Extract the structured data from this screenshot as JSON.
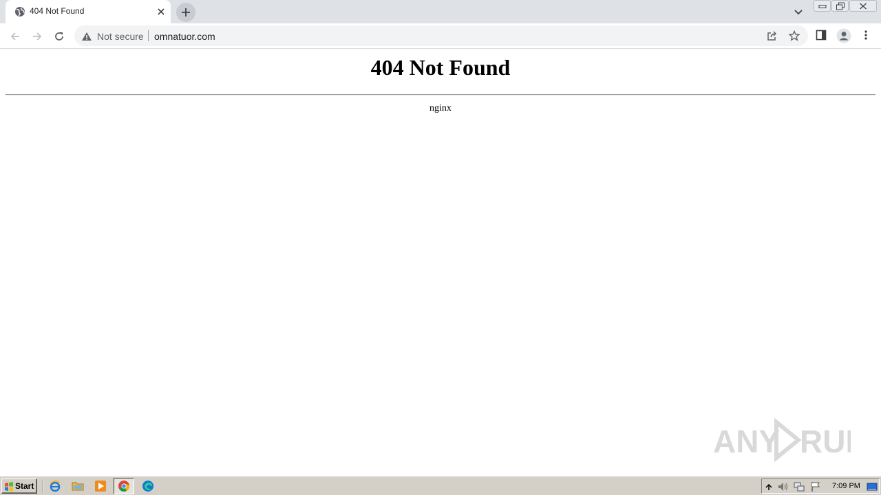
{
  "browser": {
    "tab": {
      "title": "404 Not Found",
      "favicon": "globe-icon"
    },
    "address_bar": {
      "security_label": "Not secure",
      "url": "omnatuor.com"
    },
    "icons": [
      "back-icon",
      "forward-icon",
      "reload-icon",
      "warning-icon",
      "share-icon",
      "bookmark-star-icon",
      "side-panel-icon",
      "profile-icon",
      "menu-icon",
      "new-tab-icon",
      "tab-search-icon",
      "minimize-icon",
      "restore-icon",
      "close-icon"
    ]
  },
  "page": {
    "heading": "404 Not Found",
    "server": "nginx"
  },
  "watermark": {
    "text": "ANY RUN"
  },
  "taskbar": {
    "start_label": "Start",
    "clock": "7:09 PM",
    "quick_launch": [
      "internet-explorer-icon",
      "folder-icon",
      "media-player-icon",
      "chrome-icon",
      "edge-icon"
    ],
    "tray": [
      "tray-chevron-icon",
      "volume-icon",
      "network-icon",
      "action-center-flag-icon",
      "show-desktop-icon"
    ]
  },
  "colors": {
    "tabstrip": "#dee1e6",
    "omnibox": "#f1f3f4",
    "taskbar": "#d4d0c8"
  }
}
